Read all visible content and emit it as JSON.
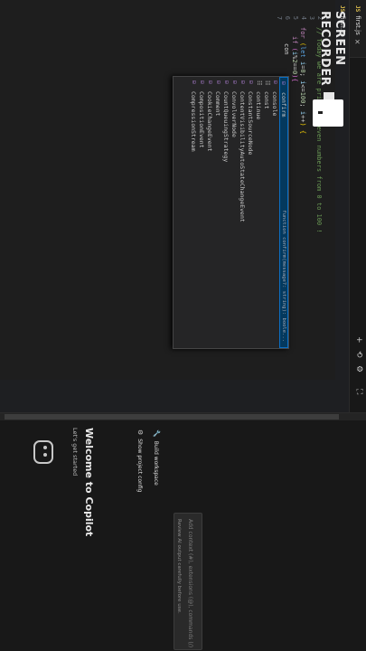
{
  "tab": {
    "icon": "JS",
    "label": "first.js",
    "close": "×"
  },
  "breadcrumb": {
    "icon": "JS",
    "file": "first.js",
    "sep": ">",
    "more": "..."
  },
  "toolbar": {
    "plus": "+",
    "history": "⟲",
    "settings": "⚙",
    "more": "⋯",
    "split": "⛶"
  },
  "editor": {
    "lines": [
      "1",
      "2",
      "3",
      "4",
      "5",
      "6",
      "7"
    ],
    "comment": "// Today we are print all even numbers from 0 to 100 !",
    "for_kw": "for",
    "for_open": " (",
    "let_kw": "let",
    "i": "i",
    "eq0": "=",
    "zero": "0",
    "semi1": "; ",
    "i2": "i",
    "le": "<=",
    "hundred": "100",
    "semi2": "; ",
    "i3": "i",
    "inc": "++",
    "close_paren": ") {",
    "if_kw": "if",
    "if_open": " (",
    "i4": "i",
    "mod": "%",
    "two": "2",
    "eqeq": "==",
    "zero2": "0",
    "if_close": "){",
    "typed": "con",
    "brace_close": "}"
  },
  "suggestions": [
    {
      "icon": "⊟",
      "text": "confirm",
      "detail": "function confirm(message?: string): boole...",
      "selected": true
    },
    {
      "icon": "⊟",
      "text": "console",
      "detail": ""
    },
    {
      "icon": "☷",
      "text": "const",
      "detail": ""
    },
    {
      "icon": "☷",
      "text": "continue",
      "detail": ""
    },
    {
      "icon": "⊟",
      "text": "ConstantSourceNode",
      "detail": ""
    },
    {
      "icon": "⊟",
      "text": "ContentVisibilityAutoStateChangeEvent",
      "detail": ""
    },
    {
      "icon": "⊟",
      "text": "ConvolverNode",
      "detail": ""
    },
    {
      "icon": "⊟",
      "text": "CountQueuingStrategy",
      "detail": ""
    },
    {
      "icon": "⊟",
      "text": "Comment",
      "detail": ""
    },
    {
      "icon": "⊟",
      "text": "CookieChangeEvent",
      "detail": ""
    },
    {
      "icon": "⊟",
      "text": "CompositionEvent",
      "detail": ""
    },
    {
      "icon": "⊟",
      "text": "CompressionStream",
      "detail": ""
    }
  ],
  "copilot": {
    "welcome": "Welcome to Copilot",
    "subtitle": "Let's get started",
    "build_workspace": "Build workspace",
    "show_config": "Show project config",
    "input_placeholder": "Add context (#), extensions (@), commands (/)",
    "review_note": "Review AI output carefully before use."
  },
  "recorder": {
    "line1": "SCREEN",
    "line2": "RECORDER"
  }
}
